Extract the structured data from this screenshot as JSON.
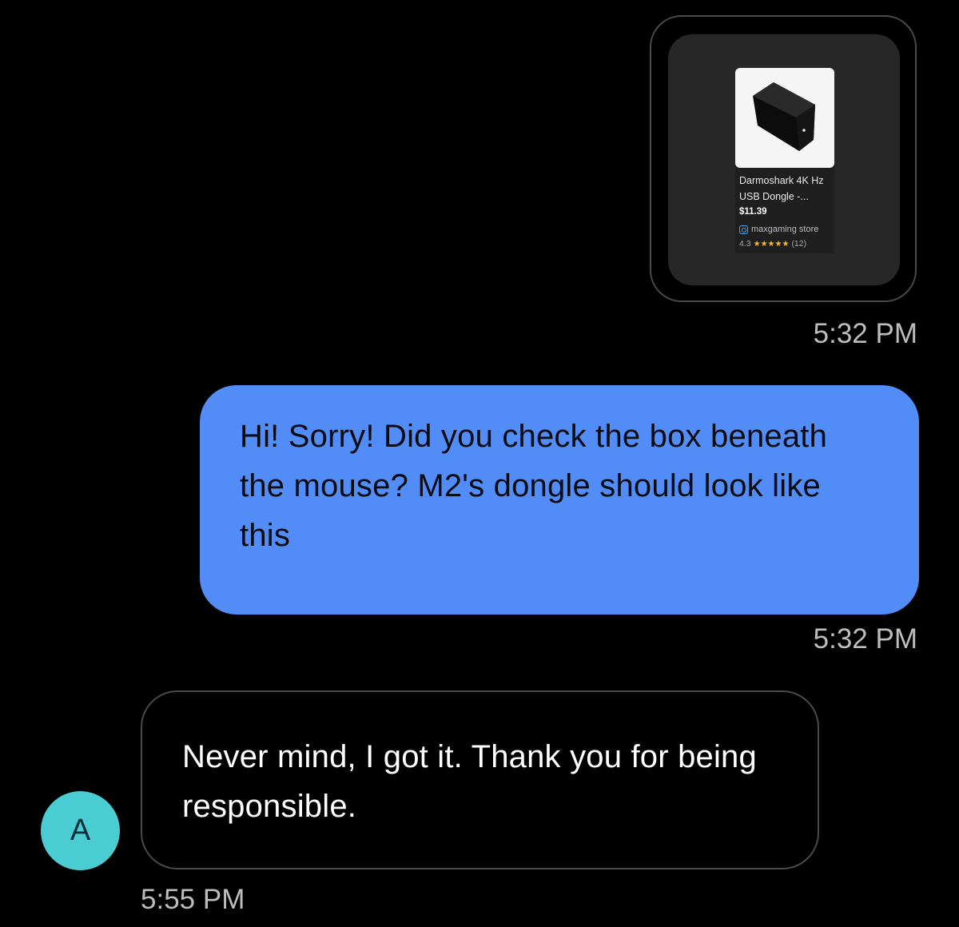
{
  "messages": [
    {
      "direction": "outgoing",
      "type": "product_card",
      "product": {
        "title_line1": "Darmoshark 4K Hz",
        "title_line2": "USB Dongle -...",
        "price": "$11.39",
        "store": "maxgaming store",
        "rating": "4.3",
        "stars": "★★★★★",
        "review_count": "(12)"
      },
      "time": "5:32 PM"
    },
    {
      "direction": "outgoing",
      "type": "text",
      "text": "Hi! Sorry! Did you check the box beneath the mouse? M2's dongle should look like this",
      "time": "5:32 PM"
    },
    {
      "direction": "incoming",
      "type": "text",
      "avatar_initial": "A",
      "text": "Never mind, I got it. Thank you for being responsible.",
      "time": "5:55 PM"
    }
  ],
  "colors": {
    "background": "#000000",
    "outgoing_bubble": "#528cf7",
    "incoming_border": "#4a4a4a",
    "avatar": "#49cdd2",
    "star": "#f5b82e"
  },
  "icons": {
    "store_icon": "store-logo-icon",
    "star_icon": "star-icon"
  }
}
